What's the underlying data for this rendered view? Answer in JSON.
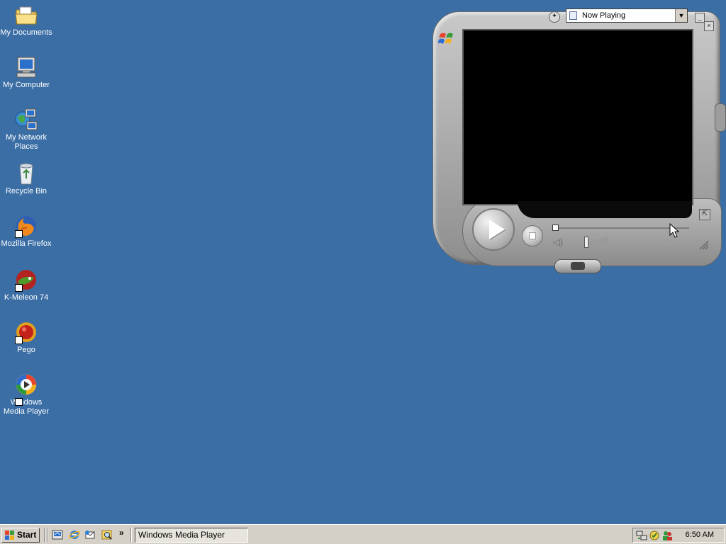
{
  "desktop": {
    "icons": [
      {
        "label": "My Documents"
      },
      {
        "label": "My Computer"
      },
      {
        "label": "My Network Places"
      },
      {
        "label": "Recycle Bin"
      },
      {
        "label": "Mozilla Firefox"
      },
      {
        "label": "K-Meleon 74"
      },
      {
        "label": "Pego"
      },
      {
        "label": "Windows Media Player"
      }
    ]
  },
  "media_player": {
    "view_selector": "Now Playing",
    "seek_position": 0.0,
    "volume_level": 0.4
  },
  "taskbar": {
    "start_label": "Start",
    "quick_launch_more": "»",
    "task_buttons": [
      {
        "label": "Windows Media Player"
      }
    ],
    "clock": "6:50 AM"
  },
  "colors": {
    "desktop_background": "#3a6ea5",
    "taskbar": "#d4d0c8"
  }
}
